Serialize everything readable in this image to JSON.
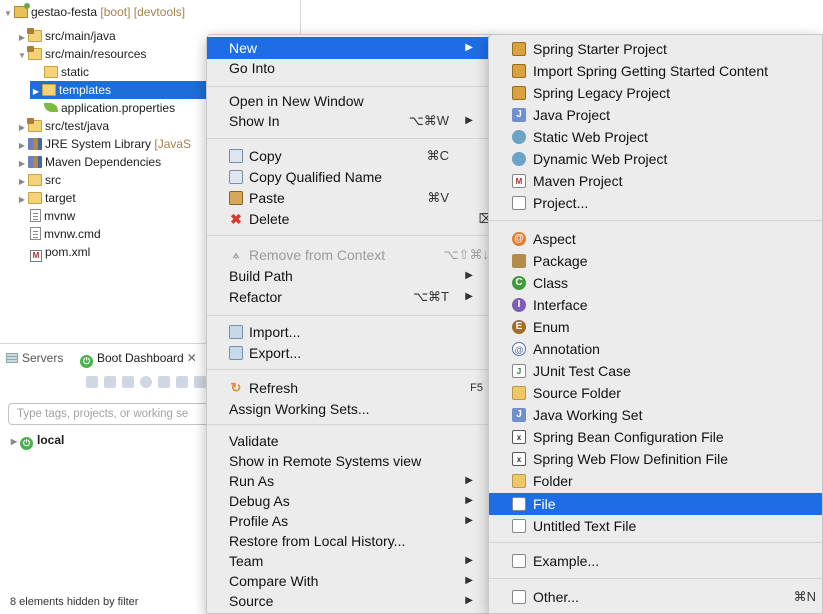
{
  "explorer": {
    "project": {
      "name": "gestao-festa",
      "decoration": "[boot] [devtools]"
    },
    "items": [
      {
        "label": "src/main/java"
      },
      {
        "label": "src/main/resources"
      },
      {
        "label": "static"
      },
      {
        "label": "templates"
      },
      {
        "label": "application.properties"
      },
      {
        "label": "src/test/java"
      },
      {
        "label": "JRE System Library",
        "decoration": "[JavaS"
      },
      {
        "label": "Maven Dependencies"
      },
      {
        "label": "src"
      },
      {
        "label": "target"
      },
      {
        "label": "mvnw"
      },
      {
        "label": "mvnw.cmd"
      },
      {
        "label": "pom.xml"
      }
    ]
  },
  "dashboard": {
    "tabs": [
      {
        "label": "Servers"
      },
      {
        "label": "Boot Dashboard"
      }
    ],
    "search_placeholder": "Type tags, projects, or working se",
    "local_label": "local",
    "status": "8 elements hidden by filter"
  },
  "main_menu": {
    "items": [
      {
        "label": "New",
        "arrow": "▶"
      },
      {
        "label": "Go Into"
      },
      {
        "label": "Open in New Window"
      },
      {
        "label": "Show In",
        "shortcut": "⌥⌘W",
        "arrow": "▶"
      },
      {
        "label": "Copy",
        "shortcut": "⌘C",
        "icon": "copy-icon"
      },
      {
        "label": "Copy Qualified Name",
        "icon": "copy-qualified-name-icon"
      },
      {
        "label": "Paste",
        "shortcut": "⌘V",
        "icon": "paste-icon"
      },
      {
        "label": "Delete",
        "shortcut": "⌦",
        "icon": "delete-icon"
      },
      {
        "label": "Remove from Context",
        "shortcut": "⌥⇧⌘↓",
        "icon": "remove-context-icon"
      },
      {
        "label": "Build Path",
        "arrow": "▶"
      },
      {
        "label": "Refactor",
        "shortcut": "⌥⌘T",
        "arrow": "▶"
      },
      {
        "label": "Import...",
        "icon": "import-icon"
      },
      {
        "label": "Export...",
        "icon": "export-icon"
      },
      {
        "label": "Refresh",
        "shortcut": "F5",
        "icon": "refresh-icon"
      },
      {
        "label": "Assign Working Sets..."
      },
      {
        "label": "Validate"
      },
      {
        "label": "Show in Remote Systems view"
      },
      {
        "label": "Run As",
        "arrow": "▶"
      },
      {
        "label": "Debug As",
        "arrow": "▶"
      },
      {
        "label": "Profile As",
        "arrow": "▶"
      },
      {
        "label": "Restore from Local History..."
      },
      {
        "label": "Team",
        "arrow": "▶"
      },
      {
        "label": "Compare With",
        "arrow": "▶"
      },
      {
        "label": "Source",
        "arrow": "▶"
      }
    ]
  },
  "sub_menu": {
    "items": [
      {
        "label": "Spring Starter Project",
        "icon": "spring-starter-icon"
      },
      {
        "label": "Import Spring Getting Started Content",
        "icon": "spring-import-icon"
      },
      {
        "label": "Spring Legacy Project",
        "icon": "spring-legacy-icon"
      },
      {
        "label": "Java Project",
        "icon": "java-project-icon"
      },
      {
        "label": "Static Web Project",
        "icon": "static-web-icon"
      },
      {
        "label": "Dynamic Web Project",
        "icon": "dynamic-web-icon"
      },
      {
        "label": "Maven Project",
        "icon": "maven-project-icon"
      },
      {
        "label": "Project...",
        "icon": "project-icon"
      },
      {
        "label": "Aspect",
        "icon": "aspect-icon"
      },
      {
        "label": "Package",
        "icon": "package-icon"
      },
      {
        "label": "Class",
        "icon": "class-icon"
      },
      {
        "label": "Interface",
        "icon": "interface-icon"
      },
      {
        "label": "Enum",
        "icon": "enum-icon"
      },
      {
        "label": "Annotation",
        "icon": "annotation-icon"
      },
      {
        "label": "JUnit Test Case",
        "icon": "junit-icon"
      },
      {
        "label": "Source Folder",
        "icon": "source-folder-icon"
      },
      {
        "label": "Java Working Set",
        "icon": "working-set-icon"
      },
      {
        "label": "Spring Bean Configuration File",
        "icon": "spring-bean-icon"
      },
      {
        "label": "Spring Web Flow Definition File",
        "icon": "spring-webflow-icon"
      },
      {
        "label": "Folder",
        "icon": "folder-icon"
      },
      {
        "label": "File",
        "icon": "file-icon"
      },
      {
        "label": "Untitled Text File",
        "icon": "text-file-icon"
      },
      {
        "label": "Example...",
        "icon": "example-icon"
      },
      {
        "label": "Other...",
        "shortcut": "⌘N",
        "icon": "other-icon"
      }
    ]
  },
  "colors": {
    "highlight": "#1d6ee6",
    "selection": "#1c6fd8",
    "menu_bg": "#ececec"
  }
}
